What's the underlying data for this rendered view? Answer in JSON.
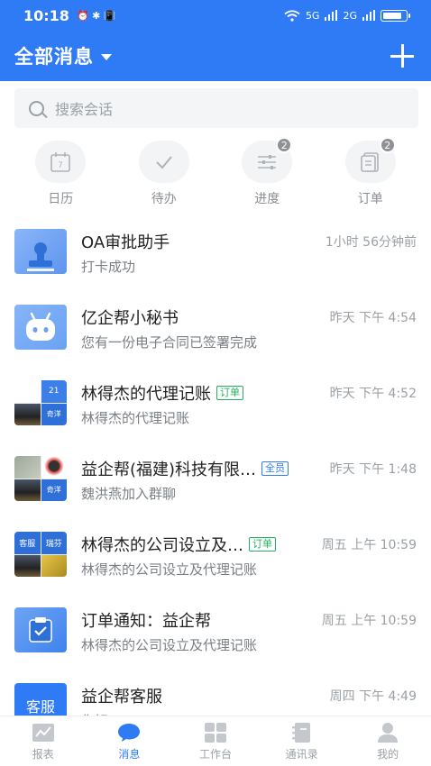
{
  "status_bar": {
    "time": "10:18",
    "left_icons": "⏰ ✱ 📳",
    "signal1": "5G",
    "signal2": "2G"
  },
  "header": {
    "title": "全部消息"
  },
  "search": {
    "placeholder": "搜索会话"
  },
  "quick_actions": [
    {
      "label": "日历",
      "icon": "calendar-icon",
      "badge": ""
    },
    {
      "label": "待办",
      "icon": "check-icon",
      "badge": ""
    },
    {
      "label": "进度",
      "icon": "sliders-icon",
      "badge": "2"
    },
    {
      "label": "订单",
      "icon": "document-icon",
      "badge": "2"
    }
  ],
  "conversations": [
    {
      "name": "OA审批助手",
      "tag": "",
      "time": "1小时 56分钟前",
      "preview": "打卡成功",
      "avatar": "stamp-icon"
    },
    {
      "name": "亿企帮小秘书",
      "tag": "",
      "time": "昨天 下午 4:54",
      "preview": "您有一份电子合同已签署完成",
      "avatar": "robot-icon"
    },
    {
      "name": "林得杰的代理记账",
      "tag": "订单",
      "tag_color": "#27ae60",
      "time": "昨天 下午 4:52",
      "preview": "林得杰的代理记账",
      "avatar_texts": [
        "21",
        "",
        "",
        "奇洋"
      ]
    },
    {
      "name": "益企帮(福建)科技有限…",
      "tag": "全员",
      "tag_color": "#2f7bf5",
      "time": "昨天 下午 1:48",
      "preview": "魏洪燕加入群聊",
      "avatar_texts": [
        "",
        "",
        "",
        "奇洋"
      ]
    },
    {
      "name": "林得杰的公司设立及…",
      "tag": "订单",
      "tag_color": "#27ae60",
      "time": "周五 上午 10:59",
      "preview": "林得杰的公司设立及代理记账",
      "avatar_texts": [
        "客服",
        "瑞芬",
        "",
        ""
      ]
    },
    {
      "name": "订单通知：益企帮",
      "tag": "",
      "time": "周五 上午 10:59",
      "preview": "林得杰的公司设立及代理记账",
      "avatar": "clipboard-icon"
    },
    {
      "name": "益企帮客服",
      "tag": "",
      "time": "周四 下午 4:49",
      "preview": "你好",
      "avatar_text": "客服"
    }
  ],
  "tabbar": [
    {
      "label": "报表",
      "icon": "report-icon",
      "active": false
    },
    {
      "label": "消息",
      "icon": "chat-icon",
      "active": true
    },
    {
      "label": "工作台",
      "icon": "workbench-icon",
      "active": false
    },
    {
      "label": "通讯录",
      "icon": "contacts-icon",
      "active": false
    },
    {
      "label": "我的",
      "icon": "profile-icon",
      "active": false
    }
  ],
  "colors": {
    "brand": "#2f7bf5",
    "tag_green": "#27ae60"
  }
}
